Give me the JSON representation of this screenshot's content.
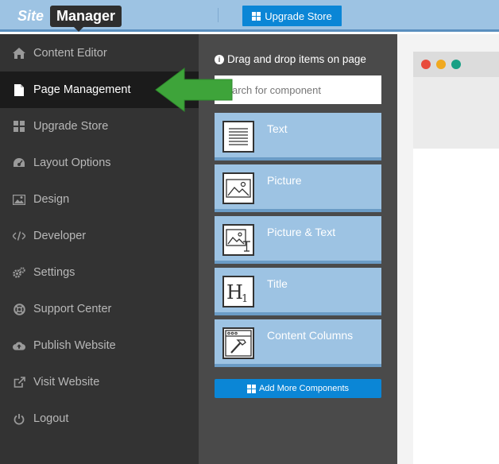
{
  "header": {
    "logo_site": "Site",
    "logo_manager": "Manager",
    "upgrade_label": "Upgrade Store"
  },
  "sidebar": {
    "items": [
      {
        "label": "Content Editor",
        "icon": "home-icon",
        "active": false
      },
      {
        "label": "Page Management",
        "icon": "file-icon",
        "active": true
      },
      {
        "label": "Upgrade Store",
        "icon": "grid-icon",
        "active": false
      },
      {
        "label": "Layout Options",
        "icon": "dashboard-icon",
        "active": false
      },
      {
        "label": "Design",
        "icon": "image-icon",
        "active": false
      },
      {
        "label": "Developer",
        "icon": "code-icon",
        "active": false
      },
      {
        "label": "Settings",
        "icon": "cogs-icon",
        "active": false
      },
      {
        "label": "Support Center",
        "icon": "lifebuoy-icon",
        "active": false
      },
      {
        "label": "Publish Website",
        "icon": "cloud-upload-icon",
        "active": false
      },
      {
        "label": "Visit Website",
        "icon": "external-link-icon",
        "active": false
      },
      {
        "label": "Logout",
        "icon": "power-icon",
        "active": false
      }
    ]
  },
  "panel": {
    "hint": "Drag and drop items on page",
    "search_placeholder": "arch for component",
    "components": [
      {
        "label": "Text",
        "icon": "text-lines-icon"
      },
      {
        "label": "Picture",
        "icon": "picture-icon"
      },
      {
        "label": "Picture & Text",
        "icon": "picture-text-icon"
      },
      {
        "label": "Title",
        "icon": "heading-h1-icon"
      },
      {
        "label": "Content Columns",
        "icon": "hammer-window-icon"
      }
    ],
    "add_more_label": "Add More Components"
  },
  "colors": {
    "topbar": "#9dc3e3",
    "sidebar": "#333333",
    "panel": "#4a4a4a",
    "accent_blue": "#0b86d6",
    "arrow_green": "#3ea43a",
    "dot_red": "#e84c3d",
    "dot_yellow": "#f0a920",
    "dot_green": "#17a085"
  }
}
